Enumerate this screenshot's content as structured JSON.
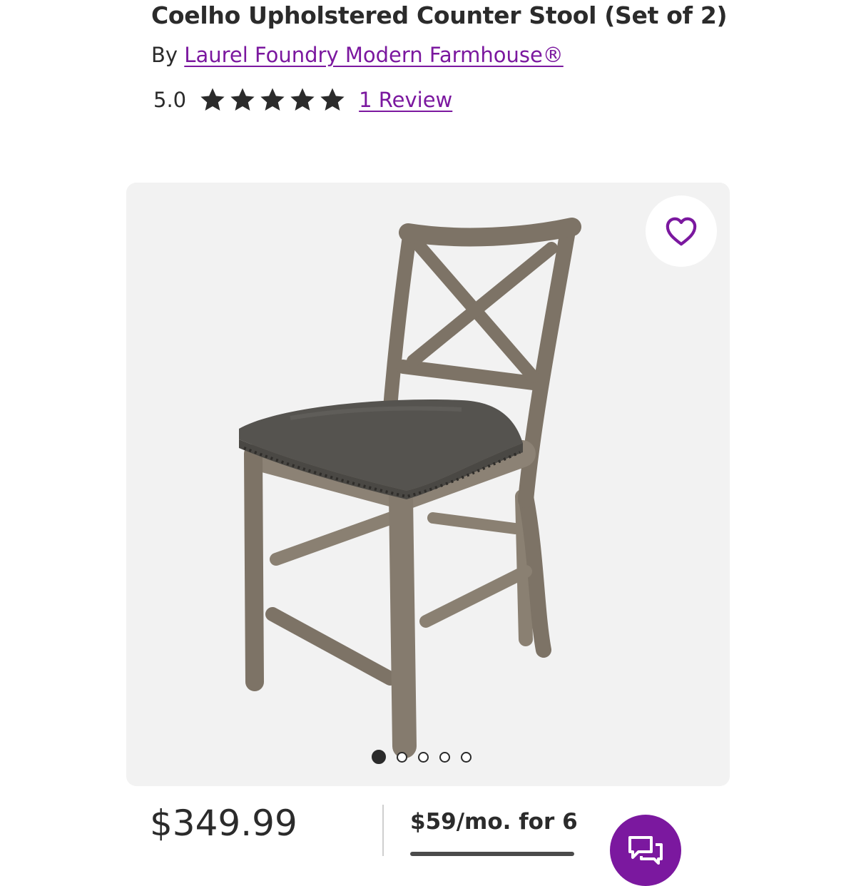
{
  "product": {
    "title": "Coelho Upholstered Counter Stool (Set of 2)",
    "by_prefix": "By",
    "brand": "Laurel Foundry Modern Farmhouse®",
    "rating_value": "5.0",
    "rating_stars": 5,
    "review_link": "1 Review"
  },
  "gallery": {
    "image_count": 5,
    "active_index": 0,
    "favorite_icon": "heart-outline-icon"
  },
  "pricing": {
    "price": "$349.99",
    "financing": "$59/mo. for 6"
  },
  "chat": {
    "icon": "chat-bubbles-icon"
  },
  "colors": {
    "brand_purple": "#7b189f",
    "text": "#2b2b2b",
    "gallery_bg": "#f2f2f2"
  }
}
